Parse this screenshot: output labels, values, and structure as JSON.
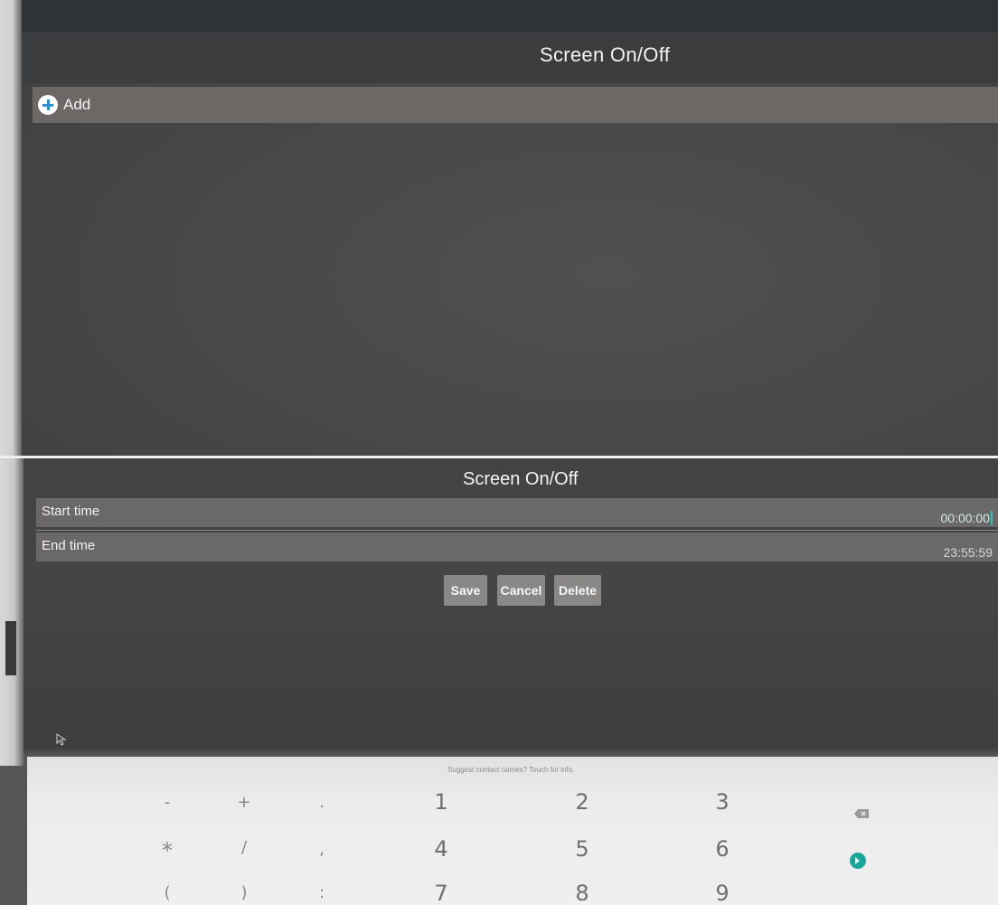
{
  "top_view": {
    "title": "Screen On/Off",
    "add_label": "Add"
  },
  "edit_view": {
    "title": "Screen On/Off",
    "fields": [
      {
        "label": "Start time",
        "value": "00:00:00"
      },
      {
        "label": "End time",
        "value": "23:55:59"
      }
    ],
    "buttons": {
      "save": "Save",
      "cancel": "Cancel",
      "delete": "Delete"
    }
  },
  "keyboard": {
    "suggestion": "Suggest contact names? Touch for info.",
    "rows": [
      [
        "-",
        "+",
        ".",
        "1",
        "2",
        "3"
      ],
      [
        "*",
        "/",
        ",",
        "4",
        "5",
        "6"
      ],
      [
        "(",
        ")",
        ":",
        "7",
        "8",
        "9"
      ]
    ],
    "accent_color": "#1aa69a"
  }
}
